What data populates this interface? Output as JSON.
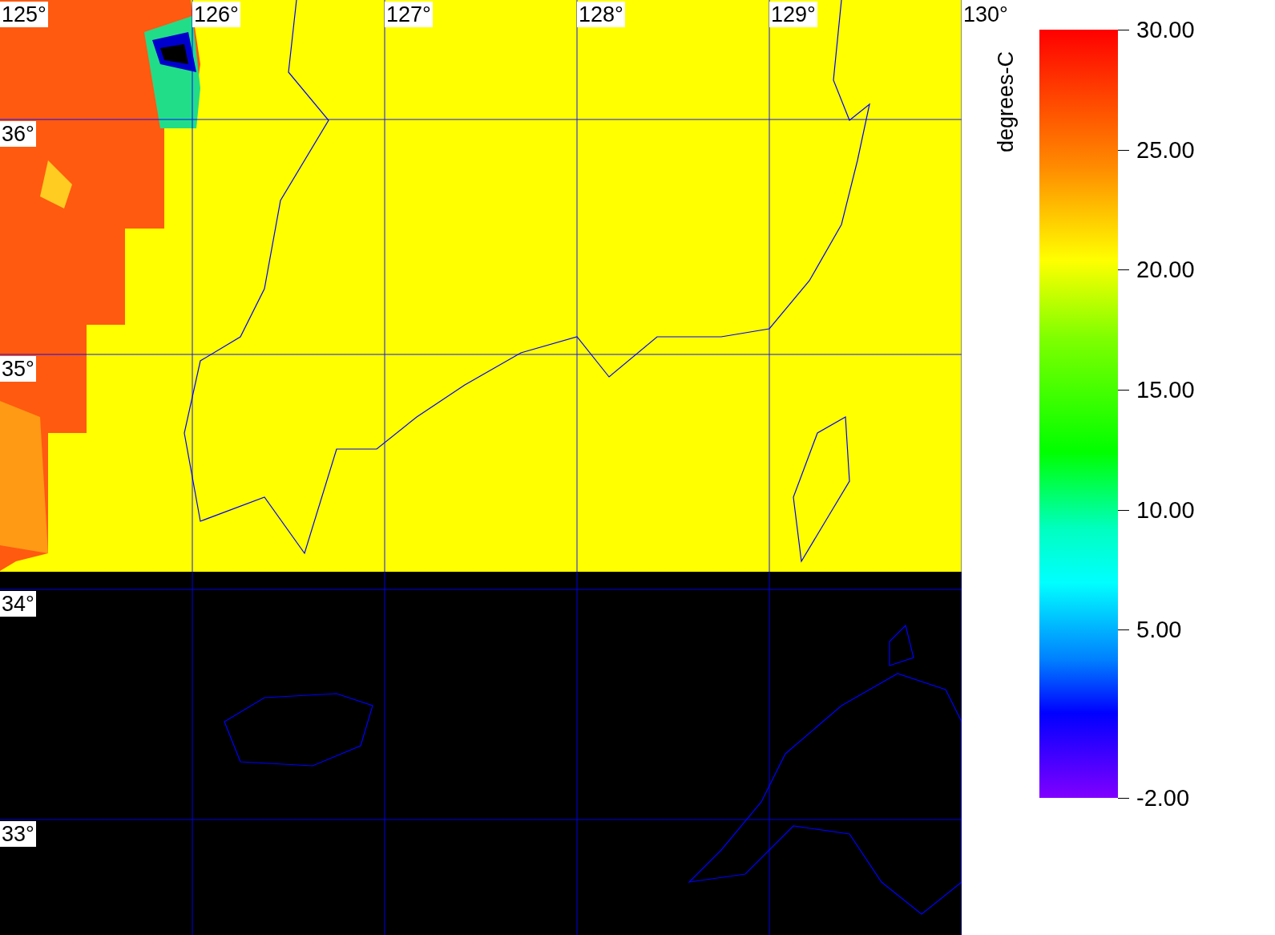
{
  "map": {
    "longitude_labels": [
      "125°",
      "126°",
      "127°",
      "128°",
      "129°",
      "130°"
    ],
    "latitude_labels": [
      "36°",
      "35°",
      "34°",
      "33°"
    ]
  },
  "colorbar": {
    "title": "degrees-C",
    "ticks": [
      "30.00",
      "25.00",
      "20.00",
      "15.00",
      "10.00",
      "5.00",
      "-2.00"
    ]
  }
}
